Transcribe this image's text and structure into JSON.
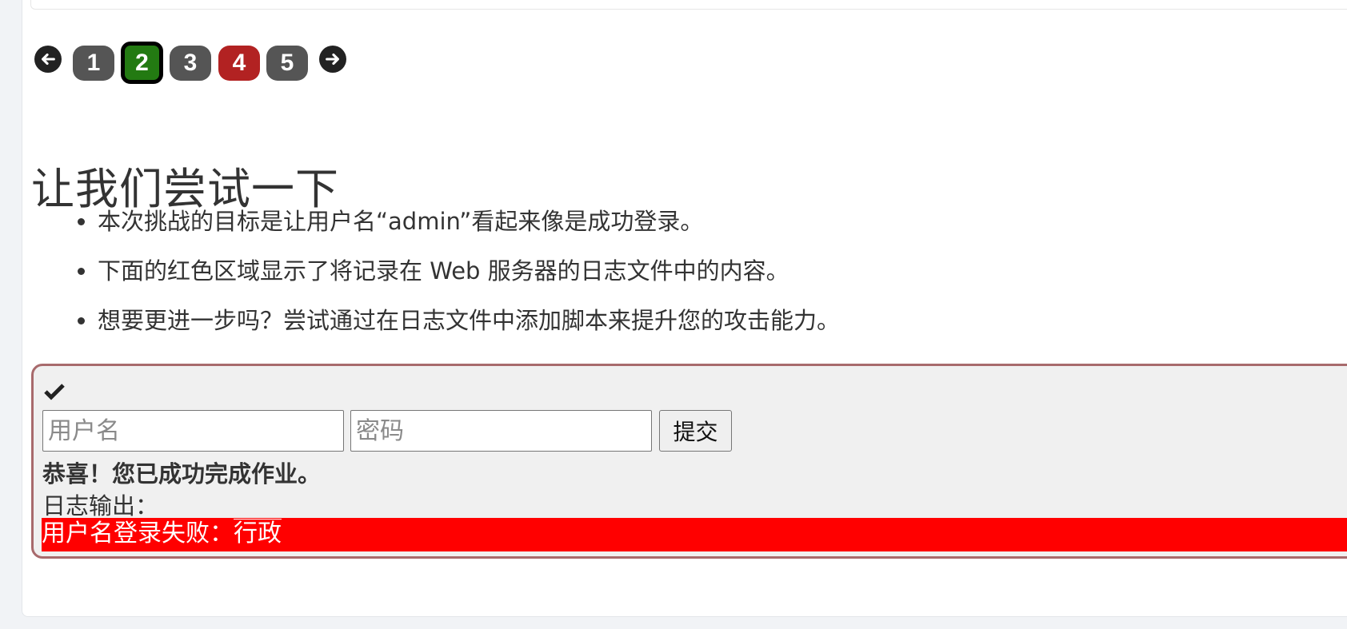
{
  "pagination": {
    "prev_icon": "arrow-left-icon",
    "next_icon": "arrow-right-icon",
    "pages": [
      {
        "label": "1",
        "status": "gray"
      },
      {
        "label": "2",
        "status": "active"
      },
      {
        "label": "3",
        "status": "gray"
      },
      {
        "label": "4",
        "status": "red"
      },
      {
        "label": "5",
        "status": "gray"
      }
    ],
    "colors": {
      "gray": "#555555",
      "active": "#237a12",
      "red": "#b22222"
    }
  },
  "lesson": {
    "title": "让我们尝试一下",
    "bullets": [
      "本次挑战的目标是让用户名“admin”看起来像是成功登录。",
      "下面的红色区域显示了将记录在 Web 服务器的日志文件中的内容。",
      "想要更进一步吗？尝试通过在日志文件中添加脚本来提升您的攻击能力。"
    ]
  },
  "attack": {
    "status_icon": "checkmark-icon",
    "username_placeholder": "用户名",
    "password_placeholder": "密码",
    "submit_label": "提交",
    "feedback": "恭喜！您已成功完成作业。",
    "log_label": "日志输出：",
    "log_prefix": "用户名登录失败：",
    "log_value": "行政",
    "log_color": "#ff0000"
  }
}
